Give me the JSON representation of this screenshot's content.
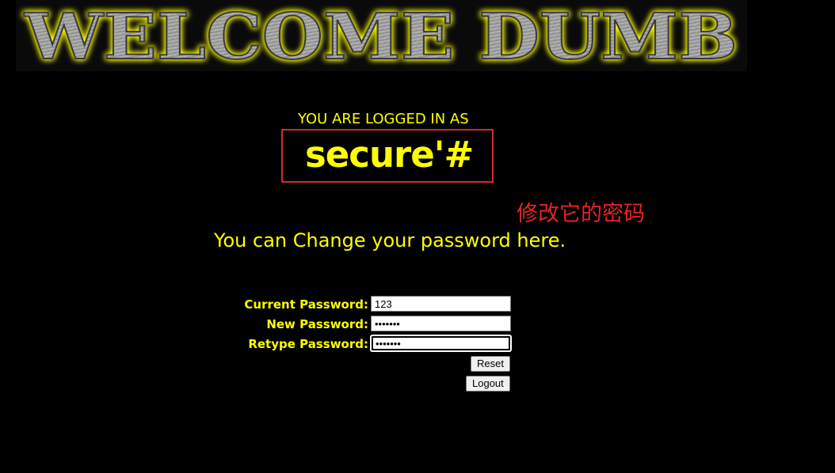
{
  "banner": {
    "title": "WELCOME DUMB",
    "glow_color": "#ffff00"
  },
  "login": {
    "label": "YOU ARE LOGGED IN AS",
    "username": "secure'#"
  },
  "annotation": "修改它的密码",
  "change_text": "You can Change your password here.",
  "form": {
    "current_password": {
      "label": "Current Password:",
      "value": "123"
    },
    "new_password": {
      "label": "New Password:",
      "value": "•••••••"
    },
    "retype_password": {
      "label": "Retype Password:",
      "value": "•••••••"
    },
    "reset_label": "Reset",
    "logout_label": "Logout"
  },
  "colors": {
    "text_yellow": "#ffff00",
    "highlight_red": "#d22a2a",
    "background": "#000000"
  }
}
